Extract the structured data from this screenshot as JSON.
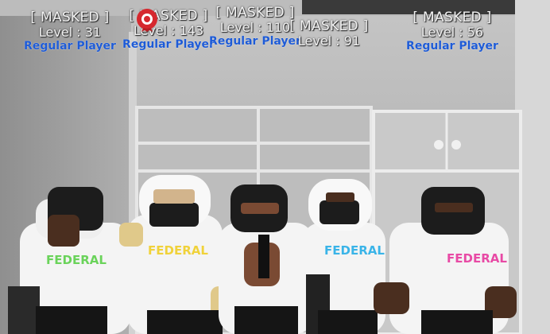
{
  "players": [
    {
      "tag": "[ MASKED ]",
      "level_text": "Level : 31",
      "role": "Regular Player"
    },
    {
      "tag": "[ MASKED ]",
      "level_text": "Level : 143",
      "role": "Regular Player"
    },
    {
      "tag": "[ MASKED ]",
      "level_text": "Level : 110",
      "role": "Regular Player"
    },
    {
      "tag": "[ MASKED ]",
      "level_text": "Level : 91",
      "role": ""
    },
    {
      "tag": "[ MASKED ]",
      "level_text": "Level : 56",
      "role": "Regular Player"
    }
  ],
  "shirt_print": "FEDERAL",
  "colors": {
    "nametag_role": "#1e5bd6",
    "nametag_text": "#f2f2f2",
    "hoodie": "#f4f4f4",
    "mask": "#1c1c1c",
    "wall": "#9a9a9a",
    "badge": "#d6282e"
  },
  "icons": {
    "badge": "award-ribbon-icon"
  }
}
